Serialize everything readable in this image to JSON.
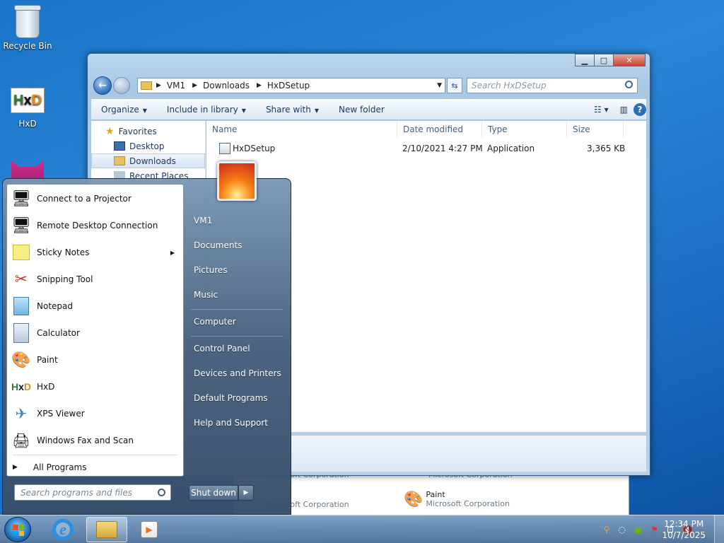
{
  "desktop": {
    "icons": [
      {
        "label": "Recycle Bin"
      },
      {
        "label": "HxD"
      }
    ]
  },
  "explorer": {
    "controls": {
      "minimize": "▁",
      "maximize": "□",
      "close": "✕"
    },
    "breadcrumbs": [
      "VM1",
      "Downloads",
      "HxDSetup"
    ],
    "search_placeholder": "Search HxDSetup",
    "toolbar": {
      "organize": "Organize",
      "include_in_library": "Include in library",
      "share_with": "Share with",
      "new_folder": "New folder"
    },
    "nav": {
      "favorites": "Favorites",
      "desktop": "Desktop",
      "downloads": "Downloads",
      "recent_places": "Recent Places"
    },
    "columns": {
      "name": "Name",
      "date_modified": "Date modified",
      "type": "Type",
      "size": "Size"
    },
    "files": [
      {
        "name": "HxDSetup",
        "date_modified": "2/10/2021 4:27 PM",
        "type": "Application",
        "size": "3,365 KB"
      }
    ]
  },
  "background_window": {
    "items": [
      {
        "title": "",
        "sub": "Microsoft Corporation"
      },
      {
        "title": "",
        "sub": "Microsoft Corporation"
      },
      {
        "title": "Paint",
        "sub": "Microsoft Corporation"
      }
    ]
  },
  "start_menu": {
    "programs": [
      {
        "label": "Connect to a Projector",
        "icon": "projector-icon"
      },
      {
        "label": "Remote Desktop Connection",
        "icon": "remote-desktop-icon"
      },
      {
        "label": "Sticky Notes",
        "icon": "sticky-notes-icon",
        "has_submenu": true
      },
      {
        "label": "Snipping Tool",
        "icon": "scissors-icon"
      },
      {
        "label": "Notepad",
        "icon": "notepad-icon"
      },
      {
        "label": "Calculator",
        "icon": "calculator-icon"
      },
      {
        "label": "Paint",
        "icon": "paint-palette-icon"
      },
      {
        "label": "HxD",
        "icon": "hxd-icon"
      },
      {
        "label": "XPS Viewer",
        "icon": "xps-viewer-icon"
      },
      {
        "label": "Windows Fax and Scan",
        "icon": "fax-icon"
      }
    ],
    "all_programs": "All Programs",
    "search_placeholder": "Search programs and files",
    "right_links": [
      "VM1",
      "Documents",
      "Pictures",
      "Music",
      "Computer",
      "Control Panel",
      "Devices and Printers",
      "Default Programs",
      "Help and Support"
    ],
    "shutdown": "Shut down"
  },
  "taskbar": {
    "time": "12:34 PM",
    "date": "10/7/2025"
  }
}
